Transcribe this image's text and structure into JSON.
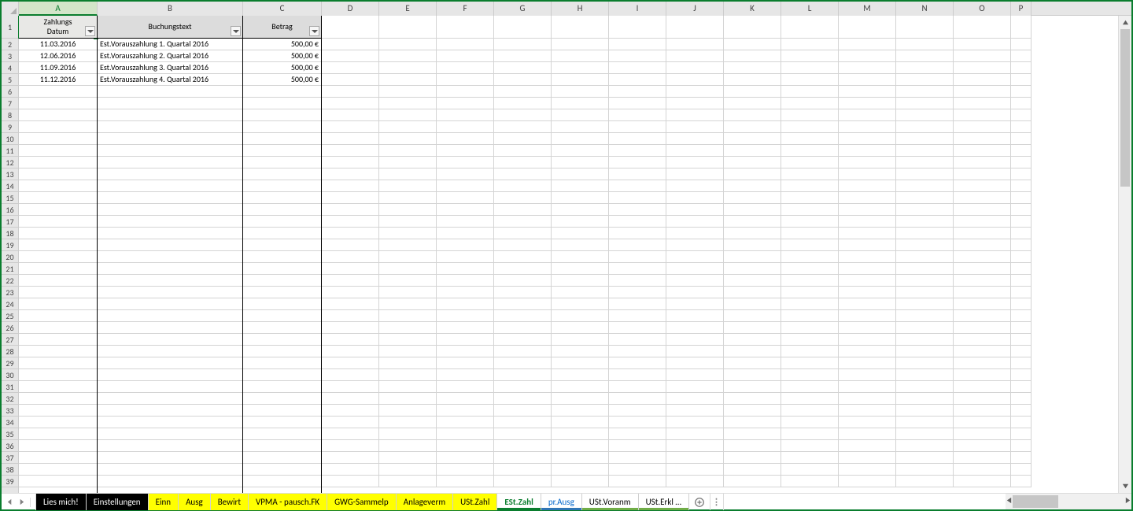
{
  "columns": {
    "letters": [
      "A",
      "B",
      "C",
      "D",
      "E",
      "F",
      "G",
      "H",
      "I",
      "J",
      "K",
      "L",
      "M",
      "N",
      "O",
      "P"
    ],
    "widths": [
      100,
      185,
      100,
      73,
      73,
      73,
      73,
      73,
      73,
      73,
      73,
      73,
      73,
      73,
      73,
      26
    ],
    "boldLinesAfter": [
      0,
      1,
      2
    ]
  },
  "headers": {
    "A_line1": "Zahlungs",
    "A_line2": "Datum",
    "B": "Buchungstext",
    "C": "Betrag"
  },
  "rows": [
    {
      "date": "11.03.2016",
      "text": "Est.Vorauszahlung 1. Quartal 2016",
      "amount": "500,00 €"
    },
    {
      "date": "12.06.2016",
      "text": "Est.Vorauszahlung 2. Quartal 2016",
      "amount": "500,00 €"
    },
    {
      "date": "11.09.2016",
      "text": "Est.Vorauszahlung 3. Quartal 2016",
      "amount": "500,00 €"
    },
    {
      "date": "11.12.2016",
      "text": "Est.Vorauszahlung 4. Quartal 2016",
      "amount": "500,00 €"
    }
  ],
  "emptyRowCount": 34,
  "firstRowNumber": 1,
  "sheets": [
    {
      "label": "Lies mich!",
      "style": "black"
    },
    {
      "label": "Einstellungen",
      "style": "black"
    },
    {
      "label": "Einn",
      "style": "yellow"
    },
    {
      "label": "Ausg",
      "style": "yellow"
    },
    {
      "label": "Bewirt",
      "style": "yellow"
    },
    {
      "label": "VPMA - pausch.FK",
      "style": "yellow"
    },
    {
      "label": "GWG-Sammelp",
      "style": "yellow"
    },
    {
      "label": "Anlageverm",
      "style": "yellow"
    },
    {
      "label": "USt.Zahl",
      "style": "yellow"
    },
    {
      "label": "ESt.Zahl",
      "style": "active"
    },
    {
      "label": "pr.Ausg",
      "style": "blue"
    },
    {
      "label": "USt.Voranm",
      "style": "green"
    },
    {
      "label": "USt.Erkl …",
      "style": "part"
    }
  ],
  "selectedColumn": "A"
}
